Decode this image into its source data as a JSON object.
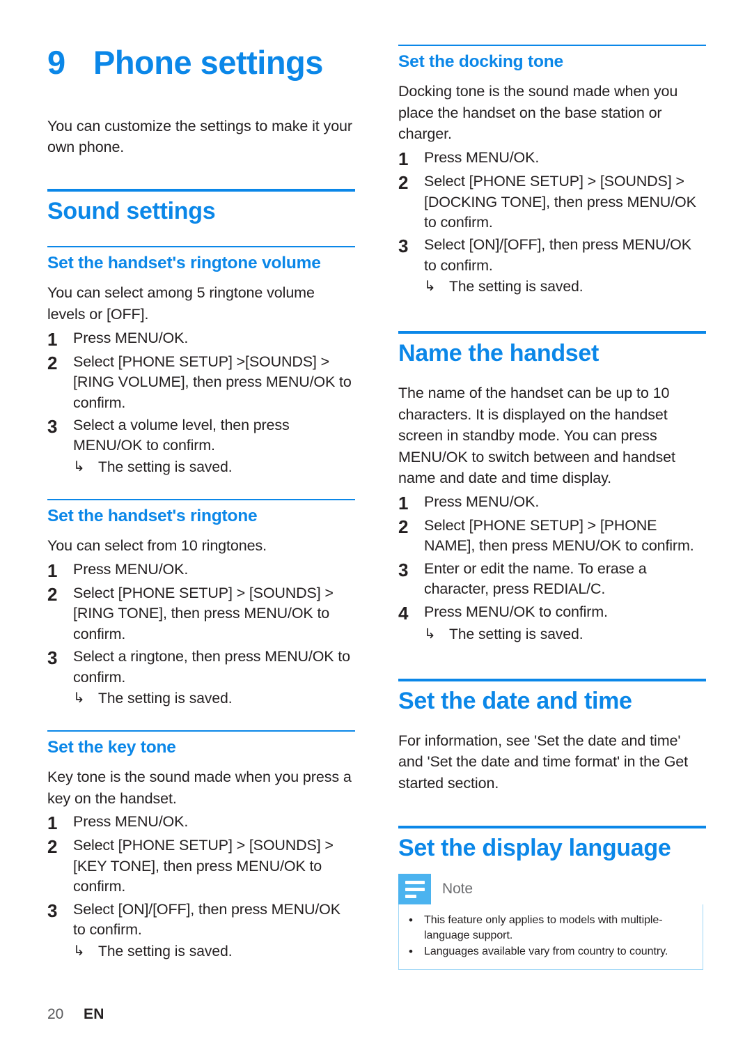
{
  "theme": {
    "accent": "#0b87e8",
    "note_icon_bg": "#4bb3ef",
    "note_border": "#9ed6f6",
    "text": "#231f20"
  },
  "chapter": {
    "number": "9",
    "title": "Phone settings",
    "intro": "You can customize the settings to make it your own phone."
  },
  "arrow_glyph": "↳",
  "bullet_glyph": "•",
  "left_column": {
    "section": {
      "title": "Sound settings"
    },
    "subsections": [
      {
        "title": "Set the handset's ringtone volume",
        "body": "You can select among 5 ringtone volume levels or [OFF].",
        "steps": [
          {
            "num": "1",
            "text": "Press MENU/OK."
          },
          {
            "num": "2",
            "text": "Select [PHONE SETUP] >[SOUNDS] > [RING VOLUME], then press MENU/OK to confirm."
          },
          {
            "num": "3",
            "text": "Select a volume level, then press MENU/OK to confirm.",
            "result": "The setting is saved."
          }
        ]
      },
      {
        "title": "Set the handset's ringtone",
        "body": "You can select from 10 ringtones.",
        "steps": [
          {
            "num": "1",
            "text": "Press MENU/OK."
          },
          {
            "num": "2",
            "text": "Select [PHONE SETUP] > [SOUNDS] > [RING TONE], then press MENU/OK to confirm."
          },
          {
            "num": "3",
            "text": "Select a ringtone, then press MENU/OK to confirm.",
            "result": "The setting is saved."
          }
        ]
      },
      {
        "title": "Set the key tone",
        "body": "Key tone is the sound made when you press a key on the handset.",
        "steps": [
          {
            "num": "1",
            "text": "Press MENU/OK."
          },
          {
            "num": "2",
            "text": "Select [PHONE SETUP] > [SOUNDS] > [KEY TONE], then press MENU/OK to confirm."
          },
          {
            "num": "3",
            "text": "Select [ON]/[OFF], then press MENU/OK to confirm.",
            "result": "The setting is saved."
          }
        ]
      }
    ]
  },
  "right_column": {
    "docking": {
      "title": "Set the docking tone",
      "body": "Docking tone is the sound made when you place the handset on the base station or charger.",
      "steps": [
        {
          "num": "1",
          "text": "Press MENU/OK."
        },
        {
          "num": "2",
          "text": "Select [PHONE SETUP] > [SOUNDS] > [DOCKING TONE], then press MENU/OK to confirm."
        },
        {
          "num": "3",
          "text": "Select [ON]/[OFF], then press MENU/OK to confirm.",
          "result": "The setting is saved."
        }
      ]
    },
    "name_handset": {
      "title": "Name the handset",
      "body": "The name of the handset can be up to 10 characters. It is displayed on the handset screen in standby mode. You can press MENU/OK to switch between and handset name and date and time display.",
      "steps": [
        {
          "num": "1",
          "text": "Press MENU/OK."
        },
        {
          "num": "2",
          "text": "Select [PHONE SETUP] > [PHONE NAME], then press MENU/OK to confirm."
        },
        {
          "num": "3",
          "text": "Enter or edit the name. To erase a character, press REDIAL/C."
        },
        {
          "num": "4",
          "text": "Press MENU/OK to confirm.",
          "result": "The setting is saved."
        }
      ]
    },
    "date_time": {
      "title": "Set the date and time",
      "body": "For information, see 'Set the date and time' and 'Set the date and time format' in the Get started section."
    },
    "display_language": {
      "title": "Set the display language",
      "note": {
        "label": "Note",
        "items": [
          "This feature only applies to models with multiple-language support.",
          "Languages available vary from country to country."
        ]
      }
    }
  },
  "footer": {
    "page": "20",
    "language": "EN"
  }
}
